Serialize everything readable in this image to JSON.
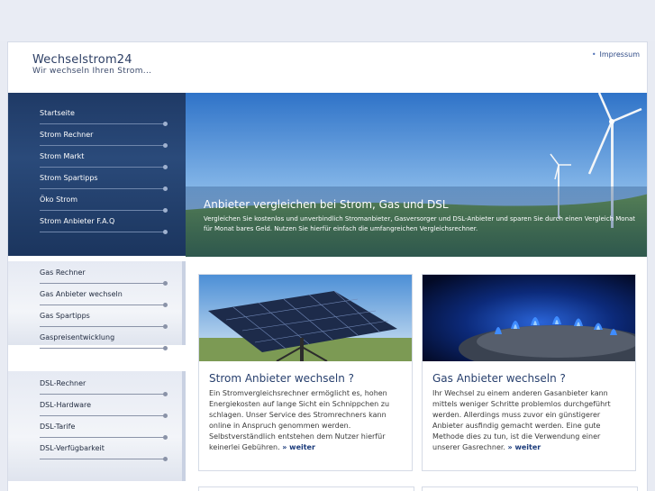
{
  "header": {
    "title": "Wechselstrom24",
    "subtitle": "Wir wechseln Ihren Strom...",
    "impressum": "Impressum"
  },
  "nav": {
    "strom": [
      {
        "label": "Startseite"
      },
      {
        "label": "Strom Rechner"
      },
      {
        "label": "Strom Markt"
      },
      {
        "label": "Strom Spartipps"
      },
      {
        "label": "Öko Strom"
      },
      {
        "label": "Strom Anbieter F.A.Q"
      }
    ],
    "gas": [
      {
        "label": "Gas Rechner"
      },
      {
        "label": "Gas Anbieter wechseln"
      },
      {
        "label": "Gas Spartipps"
      },
      {
        "label": "Gaspreisentwicklung"
      }
    ],
    "dsl": [
      {
        "label": "DSL-Rechner"
      },
      {
        "label": "DSL-Hardware"
      },
      {
        "label": "DSL-Tarife"
      },
      {
        "label": "DSL-Verfügbarkeit"
      }
    ]
  },
  "hero": {
    "title": "Anbieter vergleichen bei Strom, Gas und DSL",
    "text": "Vergleichen Sie kostenlos und unverbindlich Stromanbieter, Gasversorger und DSL-Anbieter und sparen Sie durch einen Vergleich Monat für Monat bares Geld. Nutzen Sie hierfür einfach die umfangreichen Vergleichsrechner."
  },
  "cards": [
    {
      "title": "Strom Anbieter wechseln ?",
      "text": "Ein Stromvergleichsrechner ermöglicht es, hohen Energiekosten auf lange Sicht ein Schnippchen zu schlagen. Unser Service des Stromrechners kann online in Anspruch genommen werden. Selbstverständlich entstehen dem Nutzer hierfür keinerlei Gebühren.",
      "more": "» weiter"
    },
    {
      "title": "Gas Anbieter wechseln ?",
      "text": "Ihr Wechsel zu einem anderen Gasanbieter kann mittels weniger Schritte problemlos durchgeführt werden. Allerdings muss zuvor ein günstigerer Anbieter ausfindig gemacht werden. Eine gute Methode dies zu tun, ist die Verwendung einer unserer Gasrechner.",
      "more": "» weiter"
    }
  ],
  "colors": {
    "nav_dark": "#1f3a66",
    "page_bg": "#e8ebf3",
    "title_blue": "#28406e"
  }
}
